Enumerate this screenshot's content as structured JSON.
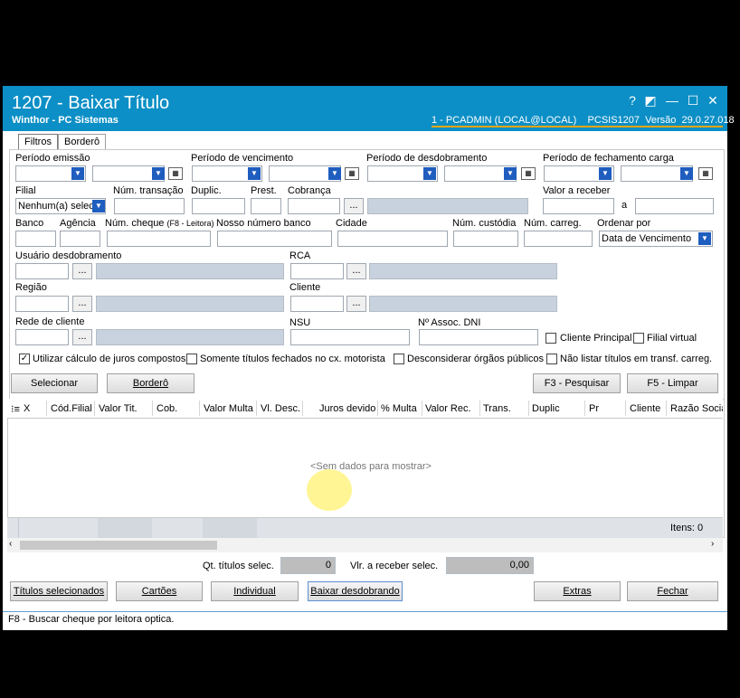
{
  "window": {
    "title": "1207 - Baixar Título",
    "subtitle": "Winthor - PC Sistemas",
    "connection": "1 - PCADMIN (LOCAL@LOCAL)    PCSIS1207  Versão  29.0.27.018",
    "controls": {
      "help": "?",
      "restore": "◩",
      "minimize": "—",
      "maximize": "☐",
      "close": "✕"
    }
  },
  "tabs": [
    {
      "label": "Filtros",
      "active": true
    },
    {
      "label": "Borderô",
      "active": false
    }
  ],
  "filters": {
    "periodo_emissao": "Período emissão",
    "periodo_vencimento": "Período de vencimento",
    "periodo_desdobramento": "Período de desdobramento",
    "periodo_fechamento": "Período de fechamento carga",
    "filial": "Filial",
    "filial_value": "Nenhum(a) selec",
    "num_transacao": "Núm. transação",
    "duplic": "Duplic.",
    "prest": "Prest.",
    "cobranca": "Cobrança",
    "valor_receber": "Valor a receber",
    "valor_a": "a",
    "banco": "Banco",
    "agencia": "Agência",
    "num_cheque": "Núm. cheque",
    "num_cheque_hint": "(F8 - Leitora)",
    "nosso_numero": "Nosso número banco",
    "cidade": "Cidade",
    "num_custodia": "Núm. custódia",
    "num_carreg": "Núm. carreg.",
    "ordenar_por": "Ordenar por",
    "ordenar_value": "Data de Vencimento",
    "usuario_desdobramento": "Usuário desdobramento",
    "rca": "RCA",
    "regiao": "Região",
    "cliente": "Cliente",
    "rede_cliente": "Rede de cliente",
    "nsu": "NSU",
    "assoc_dni": "Nº Assoc. DNI",
    "cliente_principal": "Cliente Principal",
    "filial_virtual": "Filial virtual",
    "juros_compostos": "Utilizar cálculo de juros compostos",
    "somente_fechados": "Somente títulos fechados no cx. motorista",
    "desconsiderar_orgaos": "Desconsiderar órgãos públicos",
    "nao_listar": "Não listar títulos em transf. carreg.",
    "juros_checked": true
  },
  "actions": {
    "selecionar": "Selecionar",
    "bordero": "Borderô",
    "pesquisar": "F3 - Pesquisar",
    "limpar": "F5 - Limpar"
  },
  "grid": {
    "columns": [
      "X",
      "Cód.Filial",
      "Valor Tit.",
      "Cob.",
      "Valor Multa",
      "Vl. Desc.",
      "Juros devido",
      "% Multa",
      "Valor Rec.",
      "Trans.",
      "Duplic",
      "Pr",
      "Cliente",
      "Razão Social"
    ],
    "empty_text": "<Sem dados para mostrar>",
    "items_label": "Itens: 0"
  },
  "totals": {
    "qt_label": "Qt. títulos selec.",
    "qt_value": "0",
    "vlr_label": "Vlr. a receber selec.",
    "vlr_value": "0,00"
  },
  "footer_buttons": {
    "titulos": "Títulos selecionados",
    "cartoes": "Cartões",
    "individual": "Individual",
    "baixar": "Baixar desdobrando",
    "extras": "Extras",
    "fechar": "Fechar"
  },
  "statusbar": "F8 - Buscar cheque por leitora optica."
}
